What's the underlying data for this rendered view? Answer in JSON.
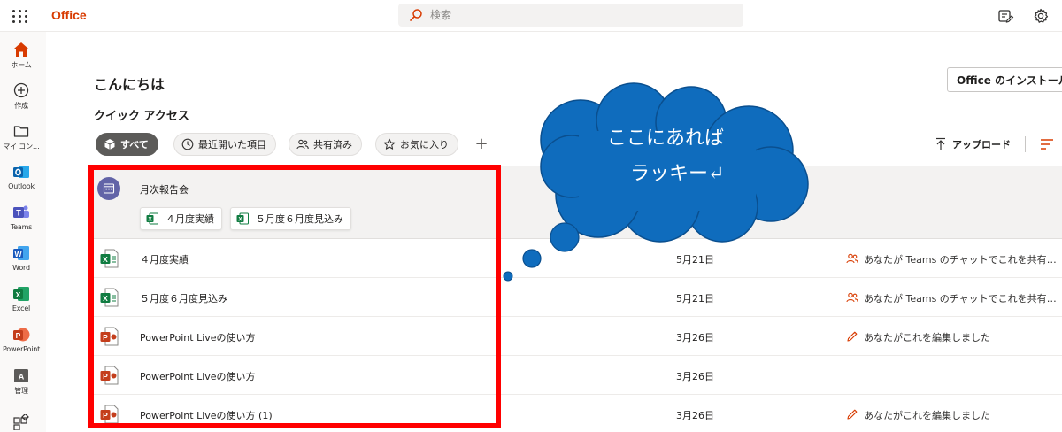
{
  "topbar": {
    "app_name": "Office",
    "search_placeholder": "検索"
  },
  "rail": [
    {
      "label": "ホーム",
      "icon": "home-icon"
    },
    {
      "label": "作成",
      "icon": "create-icon"
    },
    {
      "label": "マイ コン…",
      "icon": "folder-icon"
    },
    {
      "label": "Outlook",
      "icon": "outlook-icon"
    },
    {
      "label": "Teams",
      "icon": "teams-icon"
    },
    {
      "label": "Word",
      "icon": "word-icon"
    },
    {
      "label": "Excel",
      "icon": "excel-icon"
    },
    {
      "label": "PowerPoint",
      "icon": "powerpoint-icon"
    },
    {
      "label": "管理",
      "icon": "admin-icon"
    }
  ],
  "main": {
    "greeting": "こんにちは",
    "install_label": "Office のインストール",
    "quick_access_title": "クイック アクセス",
    "filters": [
      {
        "label": "すべて",
        "active": true
      },
      {
        "label": "最近開いた項目",
        "active": false
      },
      {
        "label": "共有済み",
        "active": false
      },
      {
        "label": "お気に入り",
        "active": false
      }
    ],
    "add_filter": "+",
    "upload_label": "アップロード"
  },
  "group": {
    "title": "月次報告会",
    "chips": [
      "４月度実績",
      "５月度６月度見込み"
    ]
  },
  "files": [
    {
      "name": "４月度実績",
      "type": "excel",
      "date": "5月21日",
      "activity": "あなたが Teams のチャットでこれを共有しました",
      "activity_icon": "people-icon"
    },
    {
      "name": "５月度６月度見込み",
      "type": "excel",
      "date": "5月21日",
      "activity": "あなたが Teams のチャットでこれを共有しました",
      "activity_icon": "people-icon"
    },
    {
      "name": "PowerPoint Liveの使い方",
      "type": "powerpoint",
      "date": "3月26日",
      "activity": "あなたがこれを編集しました",
      "activity_icon": "pencil-icon"
    },
    {
      "name": "PowerPoint Liveの使い方",
      "type": "powerpoint",
      "date": "3月26日",
      "activity": "",
      "activity_icon": ""
    },
    {
      "name": "PowerPoint Liveの使い方 (1)",
      "type": "powerpoint",
      "date": "3月26日",
      "activity": "あなたがこれを編集しました",
      "activity_icon": "pencil-icon"
    }
  ],
  "callout": {
    "line1": "ここにあれば",
    "line2": "ラッキー↵"
  },
  "colors": {
    "brand": "#d83b01",
    "highlight": "#ff0000",
    "cloud": "#0f6cbd",
    "excel": "#107c41",
    "powerpoint": "#c43e1c",
    "activity_icon": "#d83b01"
  }
}
